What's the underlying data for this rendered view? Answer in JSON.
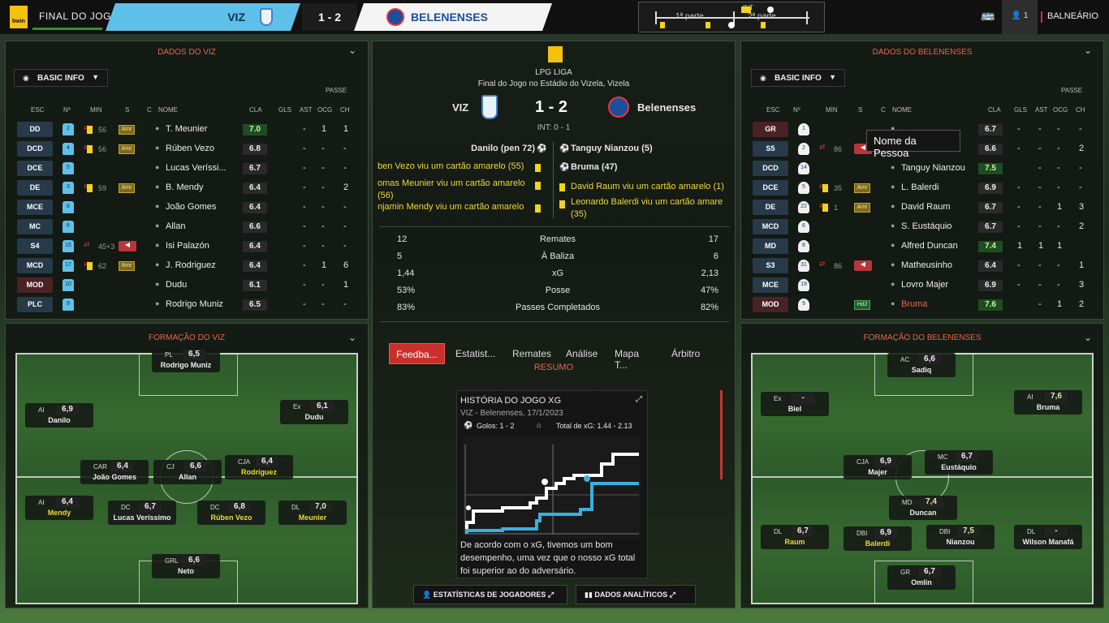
{
  "topbar": {
    "sponsor": "bwin",
    "title": "FINAL DO JOGO",
    "home": "VIZ",
    "score": "1 - 2",
    "away": "BELENENSES",
    "tl_first": "1ª parte",
    "tl_second": "2ª parte",
    "tl_ht": "INT",
    "user_count": "1",
    "balneario": "BALNEÁRIO"
  },
  "left": {
    "header": "DADOS DO VIZ",
    "view": "BASIC INFO",
    "passe": "PASSE",
    "cols": {
      "esc": "ESC",
      "no": "Nº",
      "min": "MIN",
      "s": "S",
      "c": "C",
      "nome": "NOME",
      "cla": "CLA",
      "gls": "GLS",
      "ast": "AST",
      "ocg": "OCG",
      "ch": "CH"
    },
    "rows": [
      {
        "pos": "DD",
        "num": "2",
        "min": "56",
        "s": "Amr",
        "name": "T. Meunier",
        "cla": "7.0",
        "gls": "",
        "ast": "-",
        "ocg": "1",
        "ch": "1"
      },
      {
        "pos": "DCD",
        "num": "4",
        "min": "56",
        "s": "Amr",
        "name": "Rúben Vezo",
        "cla": "6.8",
        "gls": "",
        "ast": "-",
        "ocg": "-",
        "ch": "-"
      },
      {
        "pos": "DCE",
        "num": "5",
        "min": "",
        "s": "",
        "name": "Lucas Veríssi...",
        "cla": "6.7",
        "gls": "",
        "ast": "-",
        "ocg": "-",
        "ch": "-"
      },
      {
        "pos": "DE",
        "num": "3",
        "min": "59",
        "s": "Amr",
        "name": "B. Mendy",
        "cla": "6.4",
        "gls": "",
        "ast": "-",
        "ocg": "-",
        "ch": "2"
      },
      {
        "pos": "MCE",
        "num": "8",
        "min": "",
        "s": "",
        "name": "João Gomes",
        "cla": "6.4",
        "gls": "",
        "ast": "-",
        "ocg": "-",
        "ch": "-"
      },
      {
        "pos": "MC",
        "num": "6",
        "min": "",
        "s": "",
        "name": "Allan",
        "cla": "6.6",
        "gls": "",
        "ast": "-",
        "ocg": "-",
        "ch": "-"
      },
      {
        "pos": "S4",
        "num": "15",
        "min": "45+3",
        "s": "",
        "name": "Isi Palazón",
        "cla": "6.4",
        "gls": "",
        "ast": "-",
        "ocg": "-",
        "ch": "-"
      },
      {
        "pos": "MCD",
        "num": "17",
        "min": "62",
        "s": "Amr",
        "name": "J. Rodriguez",
        "cla": "6.4",
        "gls": "",
        "ast": "-",
        "ocg": "1",
        "ch": "6"
      },
      {
        "pos": "MOD",
        "num": "10",
        "min": "",
        "s": "",
        "name": "Dudu",
        "cla": "6.1",
        "gls": "",
        "ast": "-",
        "ocg": "-",
        "ch": "1"
      },
      {
        "pos": "PLC",
        "num": "9",
        "min": "",
        "s": "",
        "name": "Rodrigo Muniz",
        "cla": "6.5",
        "gls": "",
        "ast": "-",
        "ocg": "-",
        "ch": "-"
      }
    ],
    "formation_header": "FORMAÇÃO DO VIZ",
    "formation": [
      {
        "pos": "PL",
        "rating": "6,5",
        "name": "Rodrigo Muniz",
        "hl": false,
        "green": false
      },
      {
        "pos": "AI",
        "rating": "6,9",
        "name": "Danilo",
        "hl": false,
        "green": false
      },
      {
        "pos": "Ex",
        "rating": "6,1",
        "name": "Dudu",
        "hl": false,
        "green": false
      },
      {
        "pos": "CAR",
        "rating": "6,4",
        "name": "João Gomes",
        "hl": false,
        "green": false
      },
      {
        "pos": "CJ",
        "rating": "6,6",
        "name": "Allan",
        "hl": false,
        "green": false
      },
      {
        "pos": "CJA",
        "rating": "6,4",
        "name": "Rodriguez",
        "hl": true,
        "green": false
      },
      {
        "pos": "AI",
        "rating": "6,4",
        "name": "Mendy",
        "hl": true,
        "green": false
      },
      {
        "pos": "DC",
        "rating": "6,7",
        "name": "Lucas Veríssimo",
        "hl": false,
        "green": false
      },
      {
        "pos": "DC",
        "rating": "6,8",
        "name": "Rúben Vezo",
        "hl": true,
        "green": false
      },
      {
        "pos": "DL",
        "rating": "7,0",
        "name": "Meunier",
        "hl": true,
        "green": true
      },
      {
        "pos": "GRL",
        "rating": "6,6",
        "name": "Neto",
        "hl": false,
        "green": false
      }
    ]
  },
  "center": {
    "league_logo": "bwin",
    "league": "LPG LIGA",
    "venue": "Final do Jogo no Estádio do Vizela, Vizela",
    "home": "VIZ",
    "score": "1 - 2",
    "away": "Belenenses",
    "ht": "INT: 0 - 1",
    "home_events": [
      "Danilo (pen 72)",
      "ben Vezo viu um cartão amarelo (55)",
      "omas Meunier viu um cartão amarelo (56)",
      "njamin Mendy viu um cartão amarelo"
    ],
    "away_events": [
      "Tanguy Nianzou (5)",
      "Bruma (47)",
      "David Raum viu um cartão amarelo (1)",
      "Leonardo Balerdi viu um cartão amare (35)"
    ],
    "stats": [
      {
        "h": "12",
        "label": "Remates",
        "a": "17"
      },
      {
        "h": "5",
        "label": "À Baliza",
        "a": "6"
      },
      {
        "h": "1,44",
        "label": "xG",
        "a": "2,13"
      },
      {
        "h": "53%",
        "label": "Posse",
        "a": "47%"
      },
      {
        "h": "83%",
        "label": "Passes Completados",
        "a": "82%"
      }
    ],
    "tabs": [
      "Feedba...",
      "Estatist...",
      "Remates",
      "Análise",
      "Mapa T...",
      "Árbitro"
    ],
    "resumo": "RESUMO",
    "xg": {
      "title": "HISTÓRIA DO JOGO XG",
      "sub": "VIZ - Belenenses, 17/1/2023",
      "goals": "Golos: 1 - 2",
      "total": "Total de xG: 1.44 - 2.13",
      "text": "De acordo com o xG, tivemos um bom desempenho, uma vez que o nosso xG total foi superior ao do adversário."
    },
    "btn_players": "ESTATÍSTICAS DE JOGADORES",
    "btn_data": "DADOS ANALÍTICOS"
  },
  "right": {
    "header": "DADOS DO BELENENSES",
    "view": "BASIC INFO",
    "passe": "PASSE",
    "rows": [
      {
        "pos": "GR",
        "num": "1",
        "min": "",
        "s": "",
        "name": "",
        "cla": "6.7",
        "gls": "-",
        "ast": "-",
        "ocg": "-",
        "ch": "-"
      },
      {
        "pos": "S5",
        "num": "2",
        "min": "86",
        "s": "",
        "name": "",
        "cla": "6.6",
        "gls": "-",
        "ast": "-",
        "ocg": "-",
        "ch": "2"
      },
      {
        "pos": "DCD",
        "num": "14",
        "min": "",
        "s": "",
        "name": "Tanguy Nianzou",
        "cla": "7.5",
        "gls": "",
        "ast": "-",
        "ocg": "-",
        "ch": "-"
      },
      {
        "pos": "DCE",
        "num": "5",
        "min": "35",
        "s": "Amr",
        "name": "L. Balerdi",
        "cla": "6.9",
        "gls": "-",
        "ast": "-",
        "ocg": "-",
        "ch": "-"
      },
      {
        "pos": "DE",
        "num": "22",
        "min": "1",
        "s": "Amr",
        "name": "David Raum",
        "cla": "6.7",
        "gls": "-",
        "ast": "-",
        "ocg": "1",
        "ch": "3"
      },
      {
        "pos": "MCD",
        "num": "6",
        "min": "",
        "s": "",
        "name": "S. Eustáquio",
        "cla": "6.7",
        "gls": "-",
        "ast": "-",
        "ocg": "-",
        "ch": "2"
      },
      {
        "pos": "MD",
        "num": "8",
        "min": "",
        "s": "",
        "name": "Alfred Duncan",
        "cla": "7.4",
        "gls": "1",
        "ast": "1",
        "ocg": "1",
        "ch": ""
      },
      {
        "pos": "S3",
        "num": "31",
        "min": "86",
        "s": "",
        "name": "Matheusinho",
        "cla": "6.4",
        "gls": "-",
        "ast": "-",
        "ocg": "-",
        "ch": "1"
      },
      {
        "pos": "MCE",
        "num": "19",
        "min": "",
        "s": "",
        "name": "Lovro Majer",
        "cla": "6.9",
        "gls": "-",
        "ast": "-",
        "ocg": "-",
        "ch": "3"
      },
      {
        "pos": "MOD",
        "num": "9",
        "min": "",
        "s": "HdJ",
        "name": "Bruma",
        "cla": "7.6",
        "gls": "",
        "ast": "-",
        "ocg": "1",
        "ch": "2"
      }
    ],
    "tooltip": "Nome da Pessoa",
    "formation_header": "FORMAÇÃO DO BELENENSES",
    "formation": [
      {
        "pos": "AC",
        "rating": "6,6",
        "name": "Sadiq",
        "hl": false,
        "green": false
      },
      {
        "pos": "Ex",
        "rating": "-",
        "name": "Biel",
        "hl": false,
        "green": false
      },
      {
        "pos": "AI",
        "rating": "7,6",
        "name": "Bruma",
        "hl": false,
        "green": true
      },
      {
        "pos": "CJA",
        "rating": "6,9",
        "name": "Majer",
        "hl": false,
        "green": false
      },
      {
        "pos": "MC",
        "rating": "6,7",
        "name": "Eustáquio",
        "hl": false,
        "green": false
      },
      {
        "pos": "MD",
        "rating": "7,4",
        "name": "Duncan",
        "hl": false,
        "green": true
      },
      {
        "pos": "DL",
        "rating": "6,7",
        "name": "Raum",
        "hl": true,
        "green": false
      },
      {
        "pos": "DBI",
        "rating": "6,9",
        "name": "Balerdi",
        "hl": true,
        "green": false
      },
      {
        "pos": "DBI",
        "rating": "7,5",
        "name": "Nianzou",
        "hl": false,
        "green": true
      },
      {
        "pos": "DL",
        "rating": "-",
        "name": "Wilson Manafá",
        "hl": false,
        "green": false
      },
      {
        "pos": "GR",
        "rating": "6,7",
        "name": "Omlin",
        "hl": false,
        "green": false
      }
    ]
  },
  "colors": {
    "accent": "#e8664a",
    "home": "#5ec0e8",
    "away_blue": "#1d4e9e",
    "tab_active": "#c9302c",
    "yellow": "#f2d21b"
  }
}
